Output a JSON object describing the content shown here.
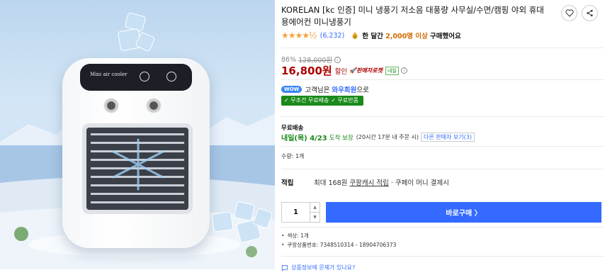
{
  "product": {
    "title": "KORELAN [kc 인증] 미니 냉풍기 저소음 대풍량 사무실/수면/캠핑 야외 휴대용에어컨 미니냉풍기",
    "image_panel_label": "Mini air cooler",
    "rating": {
      "stars": "★★★★½",
      "count": "(6,232)"
    },
    "bought": {
      "prefix": "한 달간 ",
      "highlight": "2,000명 이상",
      "suffix": " 구매했어요"
    }
  },
  "actions": {
    "wishlist_icon": "heart-icon",
    "share_icon": "share-icon"
  },
  "price": {
    "discount_rate": "86%",
    "original": "128,000원",
    "sale": "16,800원",
    "discount_label": "할인",
    "rocket_label": "🚀판매자로켓",
    "rocket_badge": "내일"
  },
  "wow": {
    "badge": "WOW",
    "text_prefix": "고객님은 ",
    "member": "와우회원",
    "text_suffix": "으로",
    "benefits": [
      "✓ 무조건 무료배송",
      "✓ 무료반품"
    ]
  },
  "shipping": {
    "label": "무료배송",
    "date": "내일(목) 4/23",
    "guarantee": "도착 보장",
    "note": "(20시간 17분 내 주문 시)",
    "other_sellers": "다른 판매자 보기(3)"
  },
  "quantity": {
    "label": "수량: 1개",
    "value": "1",
    "up": "▲",
    "down": "▼"
  },
  "cash": {
    "head": "적립",
    "text1": "최대 168원 ",
    "link": "쿠팡캐시 적립",
    "text2": " · 쿠페이 머니 결제시"
  },
  "buy_button": "바로구매 〉",
  "details": [
    "색상: 1개",
    "쿠팡상품번호: 7348510314 - 18904706373"
  ],
  "qa_link": "상품정보에 문제가 있나요?"
}
